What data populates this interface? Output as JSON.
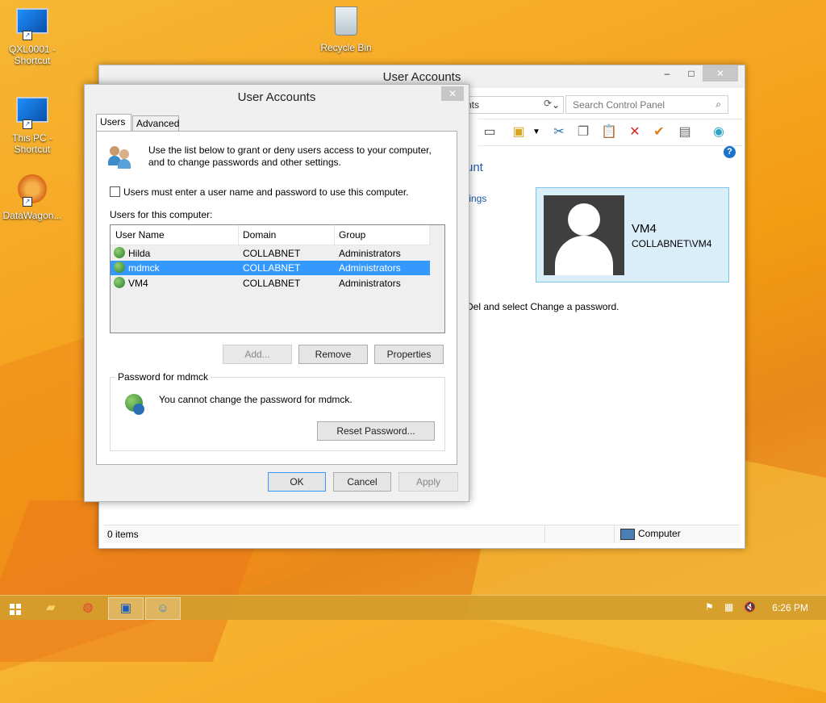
{
  "desktop": {
    "icons": [
      {
        "label": "QXL0001 - Shortcut",
        "icon": "computer-monitor-icon"
      },
      {
        "label": "Recycle Bin",
        "icon": "recycle-bin-icon"
      },
      {
        "label": "This PC - Shortcut",
        "icon": "computer-monitor-icon"
      },
      {
        "label": "DataWagon...",
        "icon": "datawagon-icon"
      }
    ]
  },
  "bg_window": {
    "title": "User Accounts",
    "controls": {
      "minimize": "–",
      "maximize": "□",
      "close": "✕"
    },
    "address_fragment": "nts",
    "search_placeholder": "Search Control Panel",
    "heading_fragment": "unt",
    "link_fragment": "tings",
    "text_fragment": "Del and select Change a password.",
    "user_card": {
      "name": "VM4",
      "domain": "COLLABNET\\VM4"
    },
    "status": {
      "items": "0 items",
      "location": "Computer"
    }
  },
  "dialog": {
    "title": "User Accounts",
    "close": "✕",
    "tabs": [
      "Users",
      "Advanced"
    ],
    "intro": "Use the list below to grant or deny users access to your computer, and to change passwords and other settings.",
    "checkbox_label": "Users must enter a user name and password to use this computer.",
    "checkbox_checked": false,
    "users_label": "Users for this computer:",
    "columns": [
      "User Name",
      "Domain",
      "Group"
    ],
    "users": [
      {
        "name": "Hilda",
        "domain": "COLLABNET",
        "group": "Administrators"
      },
      {
        "name": "mdmck",
        "domain": "COLLABNET",
        "group": "Administrators"
      },
      {
        "name": "VM4",
        "domain": "COLLABNET",
        "group": "Administrators"
      }
    ],
    "selected_user": "mdmck",
    "buttons": {
      "add": "Add...",
      "remove": "Remove",
      "properties": "Properties"
    },
    "password_group": {
      "label": "Password for mdmck",
      "message": "You cannot change the password for mdmck.",
      "reset": "Reset Password..."
    },
    "footer": {
      "ok": "OK",
      "cancel": "Cancel",
      "apply": "Apply"
    }
  },
  "taskbar": {
    "time": "6:26 PM"
  }
}
